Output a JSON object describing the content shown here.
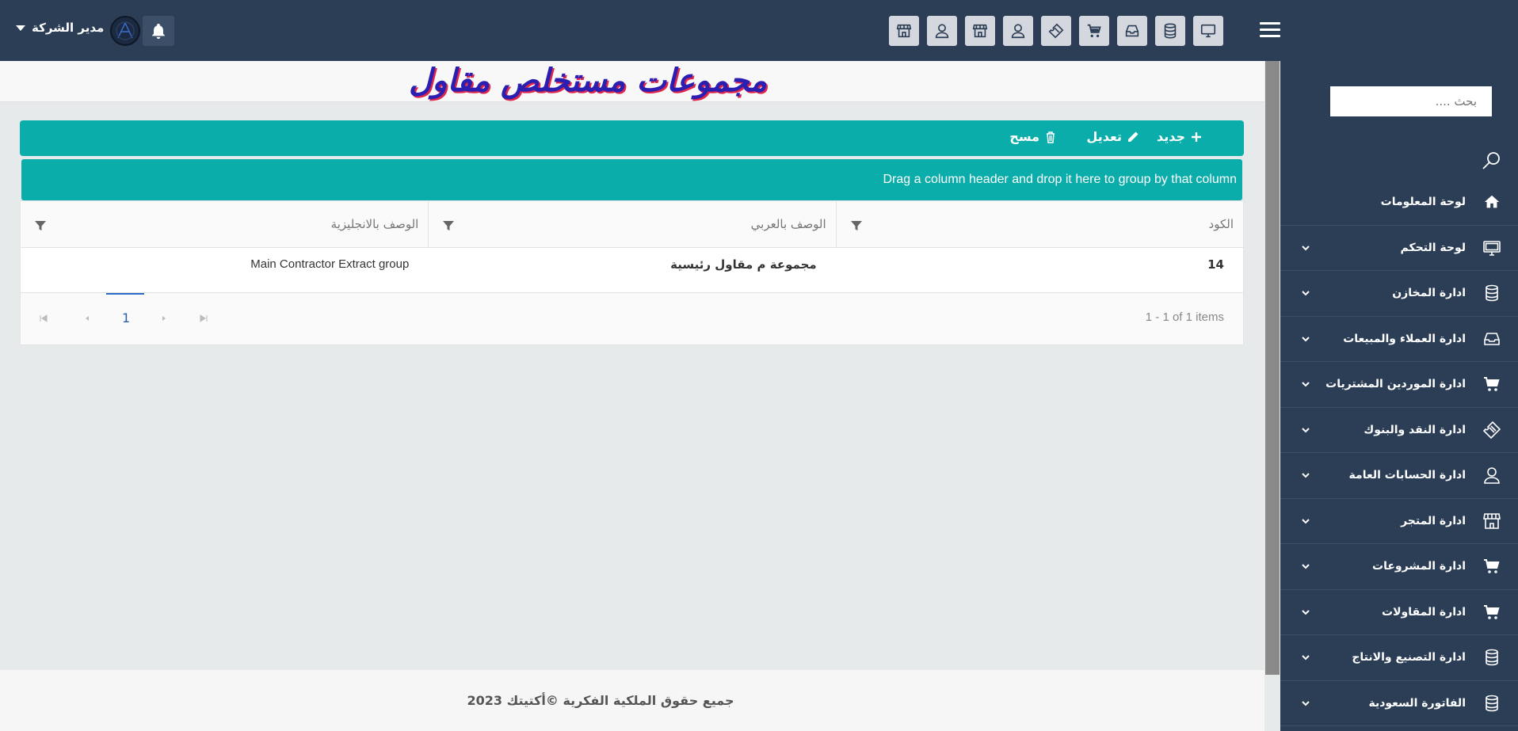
{
  "header": {
    "user_name": "مدير الشركة",
    "top_icons": [
      "monitor-icon",
      "database-icon",
      "inbox-icon",
      "cart-icon",
      "ticket-icon",
      "user-icon",
      "store-icon",
      "user-icon",
      "store-icon"
    ]
  },
  "sidebar": {
    "search_placeholder": "بحث ....",
    "items": [
      {
        "label": "لوحة المعلومات",
        "icon": "home-icon"
      },
      {
        "label": "لوحة التحكم",
        "icon": "monitor-icon"
      },
      {
        "label": "ادارة المخازن",
        "icon": "database-icon"
      },
      {
        "label": "ادارة العملاء والمبيعات",
        "icon": "inbox-icon"
      },
      {
        "label": "ادارة الموردين المشتريات",
        "icon": "cart-icon"
      },
      {
        "label": "ادارة النقد والبنوك",
        "icon": "ticket-icon"
      },
      {
        "label": "ادارة الحسابات العامة",
        "icon": "user-icon"
      },
      {
        "label": "ادارة المتجر",
        "icon": "store-icon"
      },
      {
        "label": "ادارة المشروعات",
        "icon": "cart-icon"
      },
      {
        "label": "ادارة المقاولات",
        "icon": "cart-icon"
      },
      {
        "label": "ادارة التصنيع والانتاج",
        "icon": "database-icon"
      },
      {
        "label": "الفاتورة السعودية",
        "icon": "database-icon"
      }
    ]
  },
  "page": {
    "title": "مجموعات مستخلص مقاول"
  },
  "toolbar": {
    "new_label": "جديد",
    "edit_label": "تعديل",
    "delete_label": "مسح"
  },
  "grid": {
    "group_hint": "Drag a column header and drop it here to group by that column",
    "columns": [
      "الكود",
      "الوصف بالعربي",
      "الوصف بالانجليزية"
    ],
    "rows": [
      {
        "code": "14",
        "name_ar": "مجموعة م مقاول رئيسية",
        "name_en": "Main Contractor Extract group"
      }
    ],
    "pager": {
      "current_page": "1",
      "info": "1 - 1 of 1 items"
    }
  },
  "footer": {
    "text": "جميع حقوق الملكية الفكرية ©أكتيتك 2023"
  },
  "colors": {
    "navy": "#2c3e56",
    "teal": "#0aadaa",
    "title_blue": "#2a1fb0",
    "title_red": "#e0264a"
  }
}
